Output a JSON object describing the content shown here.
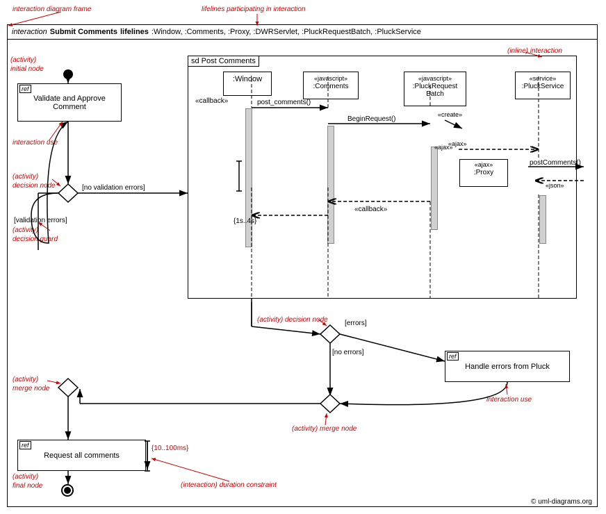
{
  "diagram": {
    "title": "interaction diagram frame",
    "header": {
      "interaction_keyword": "interaction",
      "title": "Submit Comments",
      "lifelines_keyword": "lifelines",
      "lifelines_text": ":Window, :Comments, :Proxy, :DWRServlet, :PluckRequestBatch, :PluckService"
    },
    "annotations": {
      "interaction_diagram_frame": "interaction diagram frame",
      "lifelines_participating": "lifelines participating in interaction",
      "inline_interaction": "(inline) interaction",
      "activity_initial_node": "(activity)\ninitial node",
      "interaction_use_1": "interaction use",
      "activity_decision_node_1": "(activity)\ndecision node",
      "activity_decision_guard": "(activity)\ndecision guard",
      "activity_merge_node_1": "(activity)\nmerge node",
      "activity_decision_node_2": "(activity) decision node",
      "activity_merge_node_2": "(activity) merge node",
      "interaction_use_2": "interaction use",
      "activity_final_node": "(activity)\nfinal node",
      "interaction_duration_constraint": "(interaction) duration constraint",
      "copyright": "© uml-diagrams.org"
    },
    "ref_boxes": [
      {
        "id": "validate-ref",
        "label": "ref",
        "text": "Validate and Approve Comment"
      },
      {
        "id": "errors-ref",
        "label": "ref",
        "text": "Handle errors from Pluck"
      },
      {
        "id": "request-ref",
        "label": "ref",
        "text": "Request all comments"
      }
    ],
    "sd_frame": {
      "label": "sd Post Comments",
      "lifelines": [
        {
          "id": "window",
          "text": ":Window"
        },
        {
          "id": "comments",
          "stereotype": "«javascript»",
          "text": ":Comments"
        },
        {
          "id": "pluck-batch",
          "stereotype": "«javascript»",
          "text": ":PluckRequest\nBatch"
        },
        {
          "id": "pluck-service",
          "stereotype": "«service»",
          "text": ":PluckService"
        }
      ],
      "messages": [
        {
          "id": "callback-label",
          "text": "«callback»"
        },
        {
          "id": "post-comments",
          "text": "post_comments()"
        },
        {
          "id": "begin-request",
          "text": "BeginRequest()"
        },
        {
          "id": "create-label",
          "text": "«create»"
        },
        {
          "id": "ajax-label-1",
          "text": "«ajax»"
        },
        {
          "id": "ajax-label-2",
          "text": "«ajax»"
        },
        {
          "id": "post-comments-2",
          "text": "postComments()"
        },
        {
          "id": "json-label",
          "text": "«json»"
        },
        {
          "id": "callback-label-2",
          "text": "«callback»"
        }
      ],
      "proxy": {
        "stereotype": "«ajax»",
        "text": ":Proxy"
      },
      "duration_constraint": "{1s..4s}"
    },
    "guards": {
      "no_validation_errors": "[no validation errors]",
      "validation_errors": "[validation errors]",
      "no_errors": "[no errors]",
      "errors": "[errors]"
    }
  }
}
